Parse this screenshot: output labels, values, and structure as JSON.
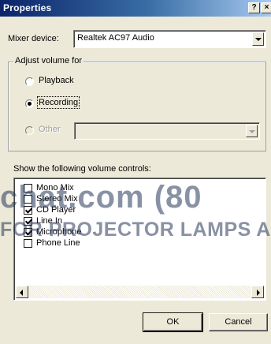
{
  "window": {
    "title": "Properties",
    "help_glyph": "?",
    "close_glyph": "×"
  },
  "mixer": {
    "label": "Mixer device:",
    "value": "Realtek AC97 Audio"
  },
  "adjust": {
    "title": "Adjust volume for",
    "options": [
      {
        "label": "Playback",
        "selected": false,
        "enabled": true
      },
      {
        "label": "Recording",
        "selected": true,
        "enabled": true
      },
      {
        "label": "Other",
        "selected": false,
        "enabled": false
      }
    ]
  },
  "controls": {
    "label": "Show the following volume controls:",
    "items": [
      {
        "label": "Mono Mix",
        "checked": false
      },
      {
        "label": "Stereo Mix",
        "checked": false
      },
      {
        "label": "CD Player",
        "checked": true
      },
      {
        "label": "Line In",
        "checked": true
      },
      {
        "label": "Microphone",
        "checked": true
      },
      {
        "label": "Phone Line",
        "checked": false
      }
    ]
  },
  "buttons": {
    "ok": "OK",
    "cancel": "Cancel"
  },
  "watermark": {
    "line1": "chat.com (80",
    "line2": "FOR PROJECTOR LAMPS A"
  }
}
